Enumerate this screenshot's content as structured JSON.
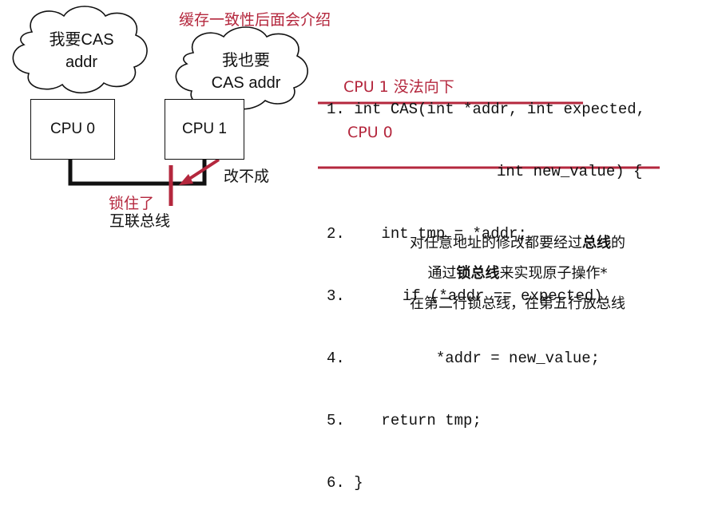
{
  "top_note": "缓存一致性后面会介绍",
  "cloud_cpu0": {
    "line1": "我要CAS",
    "line2": "addr"
  },
  "cloud_cpu1": {
    "line1": "我也要",
    "line2": "CAS addr"
  },
  "cpu0_label": "CPU 0",
  "cpu1_label": "CPU 1",
  "lock_label": "锁住了",
  "fail_label": "改不成",
  "bus_label": "互联总线",
  "code": {
    "lines": [
      {
        "num": "1.",
        "text": "int CAS(int *addr, int expected,"
      },
      {
        "num": "",
        "text": "int new_value) {"
      },
      {
        "num": "2.",
        "text": "int tmp = *addr;"
      },
      {
        "num": "3.",
        "text": "if (*addr == expected)"
      },
      {
        "num": "4.",
        "text": "*addr = new_value;"
      },
      {
        "num": "5.",
        "text": "return tmp;"
      },
      {
        "num": "6.",
        "text": "}"
      }
    ]
  },
  "annotations": {
    "cpu1_blocked": "CPU 1 没法向下",
    "cpu0_tag": "CPU 0"
  },
  "notes": {
    "line1_pre": "对任意地址的修改都要经过",
    "line1_bold": "总线",
    "line1_post": "的",
    "line2_pre": "通过",
    "line2_bold": "锁总线",
    "line2_post": "来实现原子操作*",
    "line3": "在第二行锁总线，在第五行放总线"
  },
  "colors": {
    "accent_red": "#b4273d",
    "ink": "#111111"
  }
}
